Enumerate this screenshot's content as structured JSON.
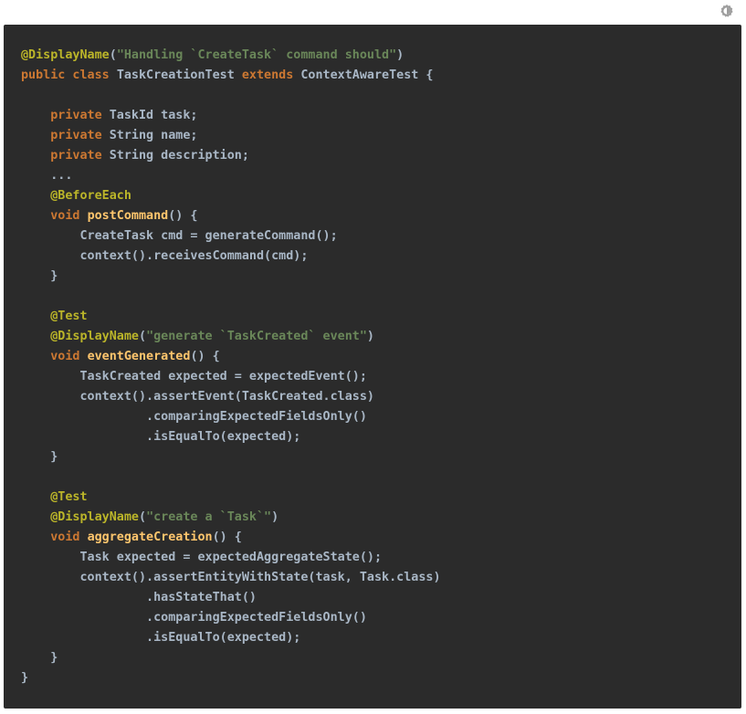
{
  "toolbar": {
    "theme_toggle_icon": "theme-toggle-icon"
  },
  "code": {
    "language": "java",
    "lines": [
      [
        {
          "t": "ann",
          "v": "@DisplayName"
        },
        {
          "t": "pl",
          "v": "("
        },
        {
          "t": "str",
          "v": "\"Handling `CreateTask` command should\""
        },
        {
          "t": "pl",
          "v": ")"
        }
      ],
      [
        {
          "t": "kw",
          "v": "public class "
        },
        {
          "t": "pl",
          "v": "TaskCreationTest "
        },
        {
          "t": "kw",
          "v": "extends "
        },
        {
          "t": "pl",
          "v": "ContextAwareTest {"
        }
      ],
      [],
      [
        {
          "t": "pl",
          "v": "    "
        },
        {
          "t": "kw",
          "v": "private "
        },
        {
          "t": "pl",
          "v": "TaskId task;"
        }
      ],
      [
        {
          "t": "pl",
          "v": "    "
        },
        {
          "t": "kw",
          "v": "private "
        },
        {
          "t": "pl",
          "v": "String name;"
        }
      ],
      [
        {
          "t": "pl",
          "v": "    "
        },
        {
          "t": "kw",
          "v": "private "
        },
        {
          "t": "pl",
          "v": "String description;"
        }
      ],
      [
        {
          "t": "pl",
          "v": "    ..."
        }
      ],
      [
        {
          "t": "pl",
          "v": "    "
        },
        {
          "t": "ann",
          "v": "@BeforeEach"
        }
      ],
      [
        {
          "t": "pl",
          "v": "    "
        },
        {
          "t": "kw",
          "v": "void "
        },
        {
          "t": "fn",
          "v": "postCommand"
        },
        {
          "t": "pl",
          "v": "() {"
        }
      ],
      [
        {
          "t": "pl",
          "v": "        CreateTask cmd = generateCommand();"
        }
      ],
      [
        {
          "t": "pl",
          "v": "        context().receivesCommand(cmd);"
        }
      ],
      [
        {
          "t": "pl",
          "v": "    }"
        }
      ],
      [],
      [
        {
          "t": "pl",
          "v": "    "
        },
        {
          "t": "ann",
          "v": "@Test"
        }
      ],
      [
        {
          "t": "pl",
          "v": "    "
        },
        {
          "t": "ann",
          "v": "@DisplayName"
        },
        {
          "t": "pl",
          "v": "("
        },
        {
          "t": "str",
          "v": "\"generate `TaskCreated` event\""
        },
        {
          "t": "pl",
          "v": ")"
        }
      ],
      [
        {
          "t": "pl",
          "v": "    "
        },
        {
          "t": "kw",
          "v": "void "
        },
        {
          "t": "fn",
          "v": "eventGenerated"
        },
        {
          "t": "pl",
          "v": "() {"
        }
      ],
      [
        {
          "t": "pl",
          "v": "        TaskCreated expected = expectedEvent();"
        }
      ],
      [
        {
          "t": "pl",
          "v": "        context().assertEvent(TaskCreated.class)"
        }
      ],
      [
        {
          "t": "pl",
          "v": "                 .comparingExpectedFieldsOnly()"
        }
      ],
      [
        {
          "t": "pl",
          "v": "                 .isEqualTo(expected);"
        }
      ],
      [
        {
          "t": "pl",
          "v": "    }"
        }
      ],
      [],
      [
        {
          "t": "pl",
          "v": "    "
        },
        {
          "t": "ann",
          "v": "@Test"
        }
      ],
      [
        {
          "t": "pl",
          "v": "    "
        },
        {
          "t": "ann",
          "v": "@DisplayName"
        },
        {
          "t": "pl",
          "v": "("
        },
        {
          "t": "str",
          "v": "\"create a `Task`\""
        },
        {
          "t": "pl",
          "v": ")"
        }
      ],
      [
        {
          "t": "pl",
          "v": "    "
        },
        {
          "t": "kw",
          "v": "void "
        },
        {
          "t": "fn",
          "v": "aggregateCreation"
        },
        {
          "t": "pl",
          "v": "() {"
        }
      ],
      [
        {
          "t": "pl",
          "v": "        Task expected = expectedAggregateState();"
        }
      ],
      [
        {
          "t": "pl",
          "v": "        context().assertEntityWithState(task, Task.class)"
        }
      ],
      [
        {
          "t": "pl",
          "v": "                 .hasStateThat()"
        }
      ],
      [
        {
          "t": "pl",
          "v": "                 .comparingExpectedFieldsOnly()"
        }
      ],
      [
        {
          "t": "pl",
          "v": "                 .isEqualTo(expected);"
        }
      ],
      [
        {
          "t": "pl",
          "v": "    }"
        }
      ],
      [
        {
          "t": "pl",
          "v": "}"
        }
      ]
    ]
  }
}
